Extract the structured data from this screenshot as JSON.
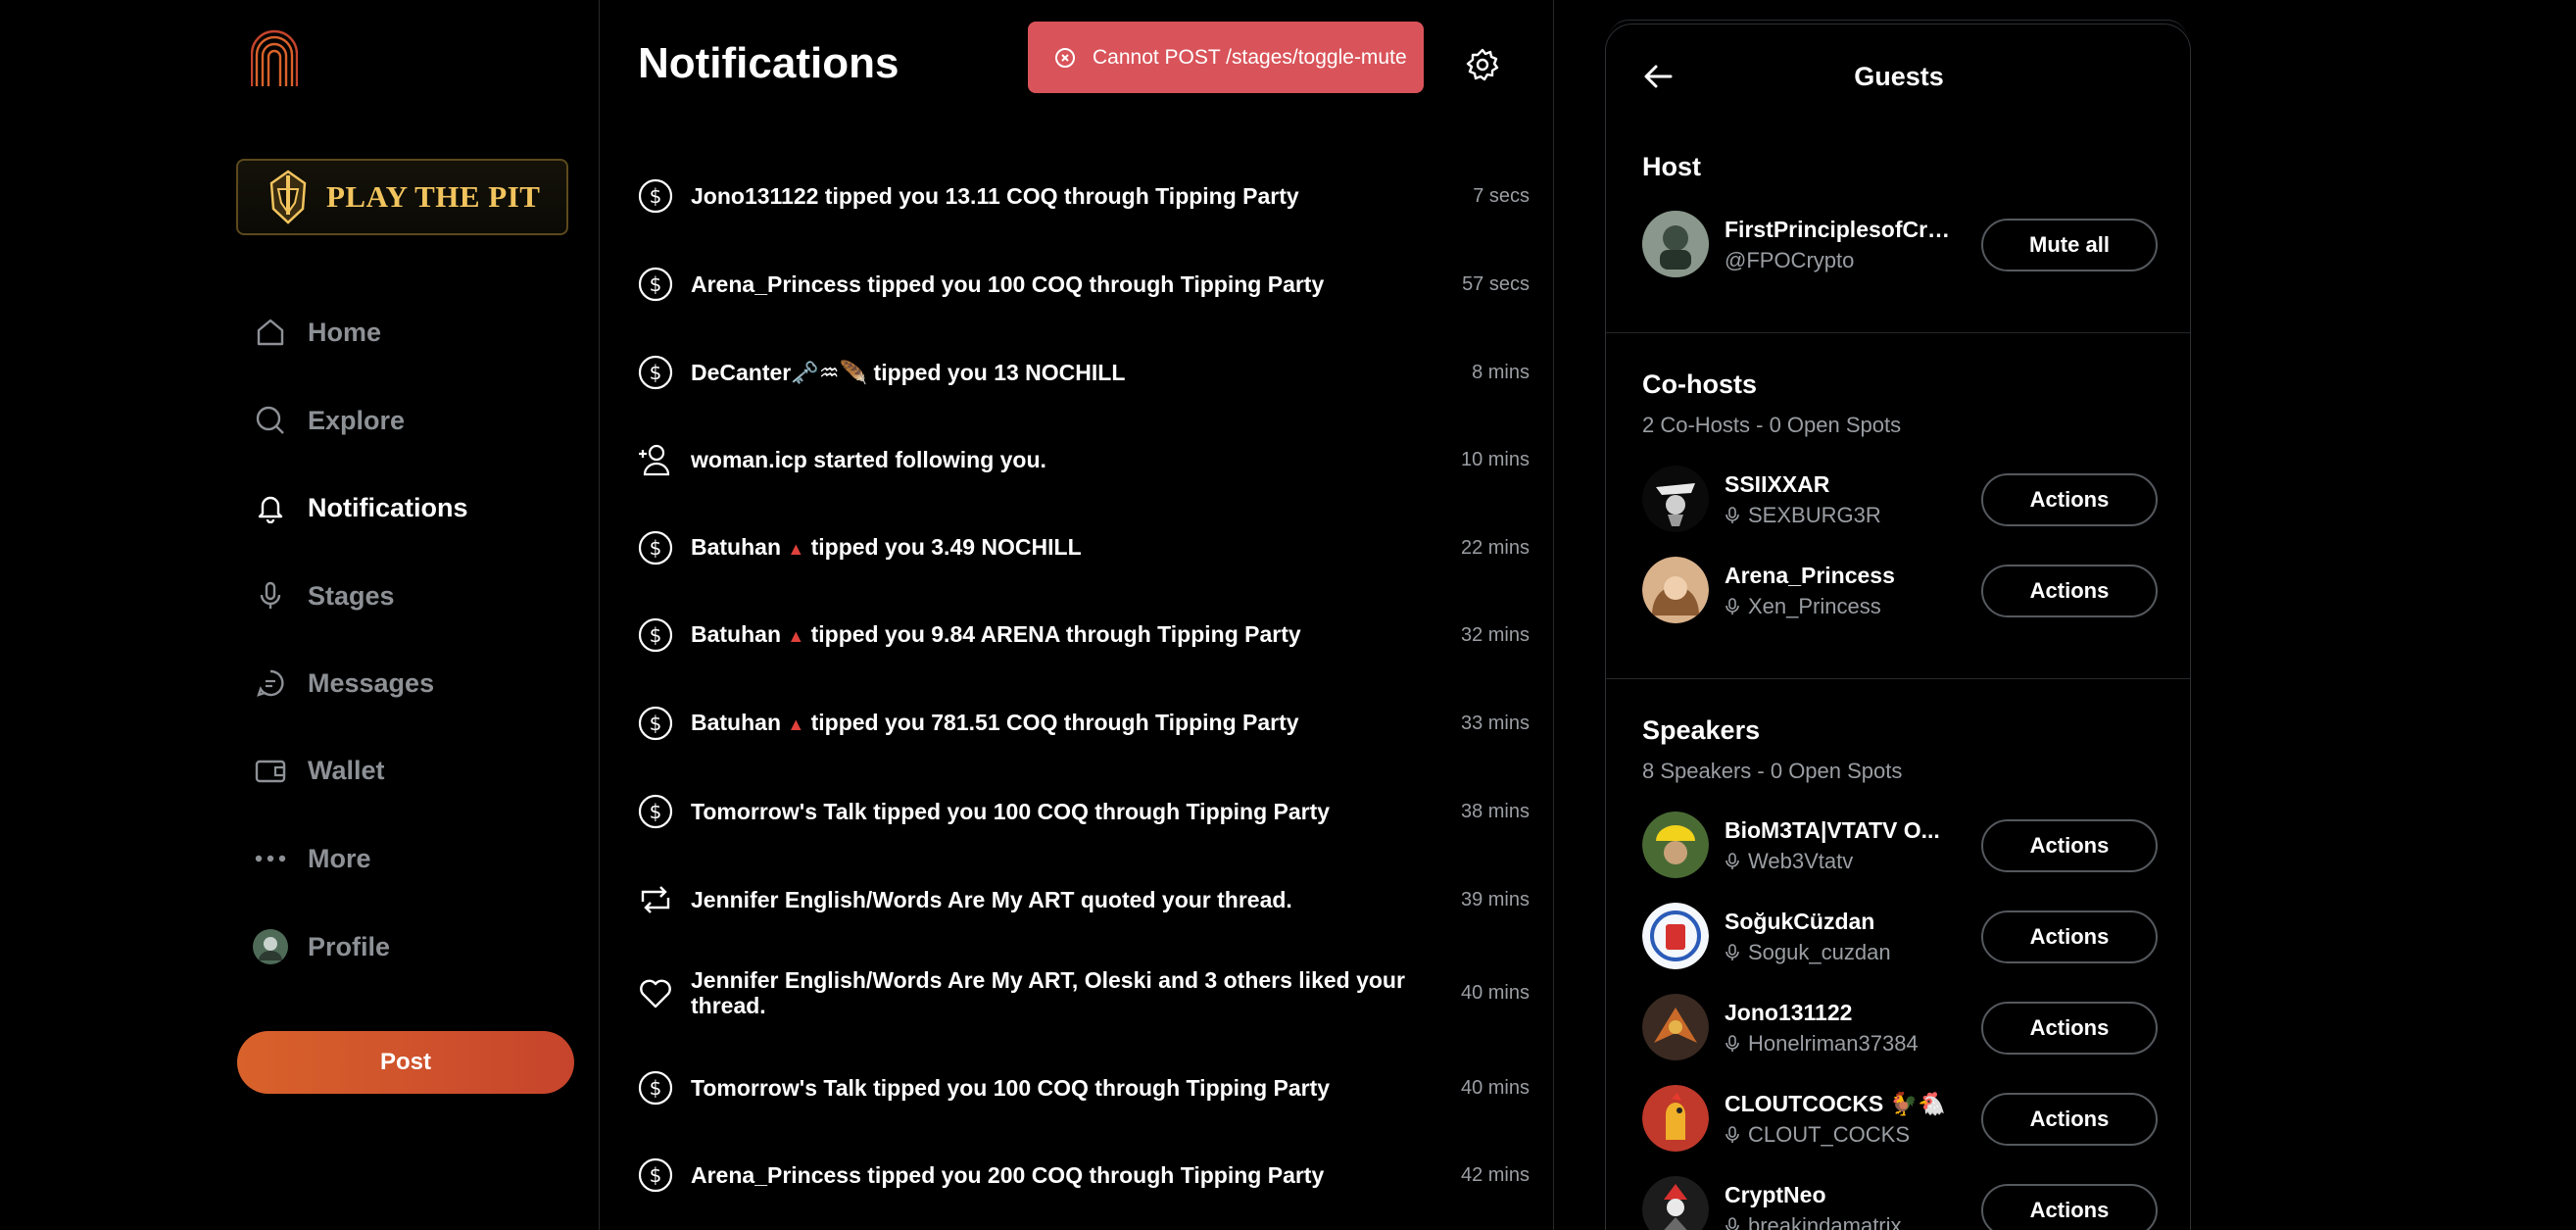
{
  "sidebar": {
    "promo_text": "PLAY THE PIT",
    "nav": [
      {
        "label": "Home",
        "icon": "home-icon"
      },
      {
        "label": "Explore",
        "icon": "search-icon"
      },
      {
        "label": "Notifications",
        "icon": "bell-icon",
        "active": true
      },
      {
        "label": "Stages",
        "icon": "microphone-icon"
      },
      {
        "label": "Messages",
        "icon": "chat-icon"
      },
      {
        "label": "Wallet",
        "icon": "wallet-icon"
      },
      {
        "label": "More",
        "icon": "more-dots-icon"
      },
      {
        "label": "Profile",
        "icon": "avatar"
      }
    ],
    "post_label": "Post"
  },
  "main": {
    "title": "Notifications",
    "toast": "Cannot POST /stages/toggle-mute",
    "notifications": [
      {
        "icon": "dollar-icon",
        "text": "Jono131122 tipped you 13.11 COQ through Tipping Party",
        "time": "7 secs"
      },
      {
        "icon": "dollar-icon",
        "text": "Arena_Princess tipped you 100 COQ through Tipping Party",
        "time": "57 secs"
      },
      {
        "icon": "dollar-icon",
        "text": "DeCanter🗝️♒🪶 tipped you 13 NOCHILL",
        "time": "8 mins"
      },
      {
        "icon": "user-plus-icon",
        "text": "woman.icp started following you.",
        "time": "10 mins"
      },
      {
        "icon": "dollar-icon",
        "name": "Batuhan",
        "rest": "tipped you 3.49 NOCHILL",
        "time": "22 mins"
      },
      {
        "icon": "dollar-icon",
        "name": "Batuhan",
        "rest": "tipped you 9.84 ARENA through Tipping Party",
        "time": "32 mins"
      },
      {
        "icon": "dollar-icon",
        "name": "Batuhan",
        "rest": "tipped you 781.51 COQ through Tipping Party",
        "time": "33 mins"
      },
      {
        "icon": "dollar-icon",
        "text": "Tomorrow's Talk tipped you 100 COQ through Tipping Party",
        "time": "38 mins"
      },
      {
        "icon": "repost-icon",
        "text": "Jennifer English/Words Are My ART quoted your thread.",
        "time": "39 mins"
      },
      {
        "icon": "heart-icon",
        "text": "Jennifer English/Words Are My ART, Oleski and 3 others liked your thread.",
        "time": "40 mins"
      },
      {
        "icon": "dollar-icon",
        "text": "Tomorrow's Talk tipped you 100 COQ through Tipping Party",
        "time": "40 mins"
      },
      {
        "icon": "dollar-icon",
        "text": "Arena_Princess tipped you 200 COQ through Tipping Party",
        "time": "42 mins"
      }
    ]
  },
  "guests": {
    "title": "Guests",
    "host": {
      "title": "Host",
      "name": "FirstPrinciplesofCry...",
      "handle": "@FPOCrypto",
      "button": "Mute all"
    },
    "cohosts": {
      "title": "Co-hosts",
      "subtitle": "2 Co-Hosts - 0 Open Spots",
      "people": [
        {
          "name": "SSIIXXAR",
          "handle": "SEXBURG3R",
          "button": "Actions",
          "color": "#e8e8e8"
        },
        {
          "name": "Arena_Princess",
          "handle": "Xen_Princess",
          "button": "Actions",
          "color": "#c9926a"
        }
      ]
    },
    "speakers": {
      "title": "Speakers",
      "subtitle": "8 Speakers - 0 Open Spots",
      "people": [
        {
          "name": "BioM3TA|VTATV O...",
          "handle": "Web3Vtatv",
          "button": "Actions",
          "color": "#5b7a3a"
        },
        {
          "name": "SoğukCüzdan",
          "handle": "Soguk_cuzdan",
          "button": "Actions",
          "color": "#e8eef7"
        },
        {
          "name": "Jono131122",
          "handle": "Honelriman37384",
          "button": "Actions",
          "color": "#7a3a2a"
        },
        {
          "name": "CLOUTCOCKS 🐓🐔",
          "handle": "CLOUT_COCKS",
          "button": "Actions",
          "color": "#c0392b"
        },
        {
          "name": "CryptNeo",
          "handle": "breakindamatrix",
          "button": "Actions",
          "color": "#2b2b2b"
        }
      ]
    }
  },
  "colors": {
    "accent": "#d9622b",
    "toast": "#d9545a",
    "muted": "#9a9ea3"
  }
}
